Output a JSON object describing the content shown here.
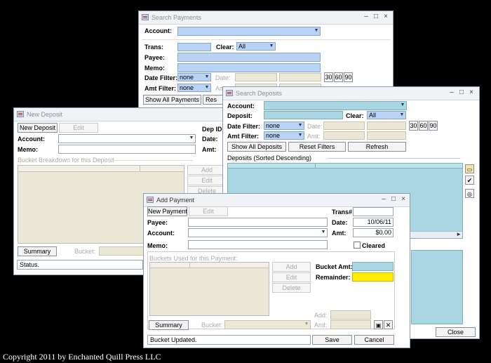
{
  "search_payments": {
    "title": "Search Payments",
    "account_label": "Account:",
    "trans_label": "Trans:",
    "clear_label": "Clear:",
    "clear_value": "All",
    "payee_label": "Payee:",
    "memo_label": "Memo:",
    "date_filter_label": "Date Filter:",
    "date_filter_value": "none",
    "date_label": "Date:",
    "amt_filter_label": "Amt Filter:",
    "amt_filter_value": "none",
    "amt_label": "Amt:",
    "d30": "30",
    "d60": "60",
    "d90": "90",
    "show_all": "Show All Payments",
    "reset": "Res"
  },
  "new_deposit": {
    "title": "New Deposit",
    "new_deposit_btn": "New Deposit",
    "edit_btn": "Edit",
    "account_label": "Account:",
    "memo_label": "Memo:",
    "dep_id_label": "Dep ID:",
    "date_label": "Date:",
    "amt_label": "Amt:",
    "bucket_section": "Bucket Breakdown for this Deposit",
    "add_btn": "Add",
    "edit2_btn": "Edit",
    "delete_btn": "Delete",
    "summary_btn": "Summary",
    "bucket_label": "Bucket:",
    "status": "Status."
  },
  "search_deposits": {
    "title": "Search Deposits",
    "account_label": "Account:",
    "deposit_label": "Deposit:",
    "clear_label": "Clear:",
    "clear_value": "All",
    "date_filter_label": "Date Filter:",
    "date_filter_value": "none",
    "date_label": "Date:",
    "amt_filter_label": "Amt Filter:",
    "amt_filter_value": "none",
    "amt_label": "Amt:",
    "d30": "30",
    "d60": "60",
    "d90": "90",
    "show_all": "Show All Deposits",
    "reset": "Reset Filters",
    "refresh": "Refresh",
    "list_title": "Deposits (Sorted Descending)",
    "close": "Close"
  },
  "add_payment": {
    "title": "Add Payment",
    "new_payment_btn": "New Payment",
    "edit_btn": "Edit",
    "trans_label": "Trans#:",
    "payee_label": "Payee:",
    "date_label": "Date:",
    "date_value": "10/06/11",
    "account_label": "Account:",
    "amt_label": "Amt:",
    "amt_value": "$0.00",
    "memo_label": "Memo:",
    "cleared_label": "Cleared",
    "buckets_section": "Buckets Used for this Payment:",
    "add_btn": "Add",
    "edit2_btn": "Edit",
    "delete_btn": "Delete",
    "bucket_amt_label": "Bucket Amt:",
    "remainder_label": "Remainder:",
    "add_label": "Add:",
    "amt2_label": "Amt:",
    "summary_btn": "Summary",
    "bucket_label": "Bucket:",
    "status": "Bucket Updated.",
    "save_btn": "Save",
    "cancel_btn": "Cancel"
  },
  "footer": {
    "copyright": "Copyright 2011 by Enchanted Quill Press LLC"
  },
  "colors": {
    "field_blue": "#b9d3f5",
    "field_aqua": "#a9d6e2",
    "field_beige": "#ebe8d8",
    "remainder_yellow": "#ffee00",
    "background": "#000000"
  }
}
